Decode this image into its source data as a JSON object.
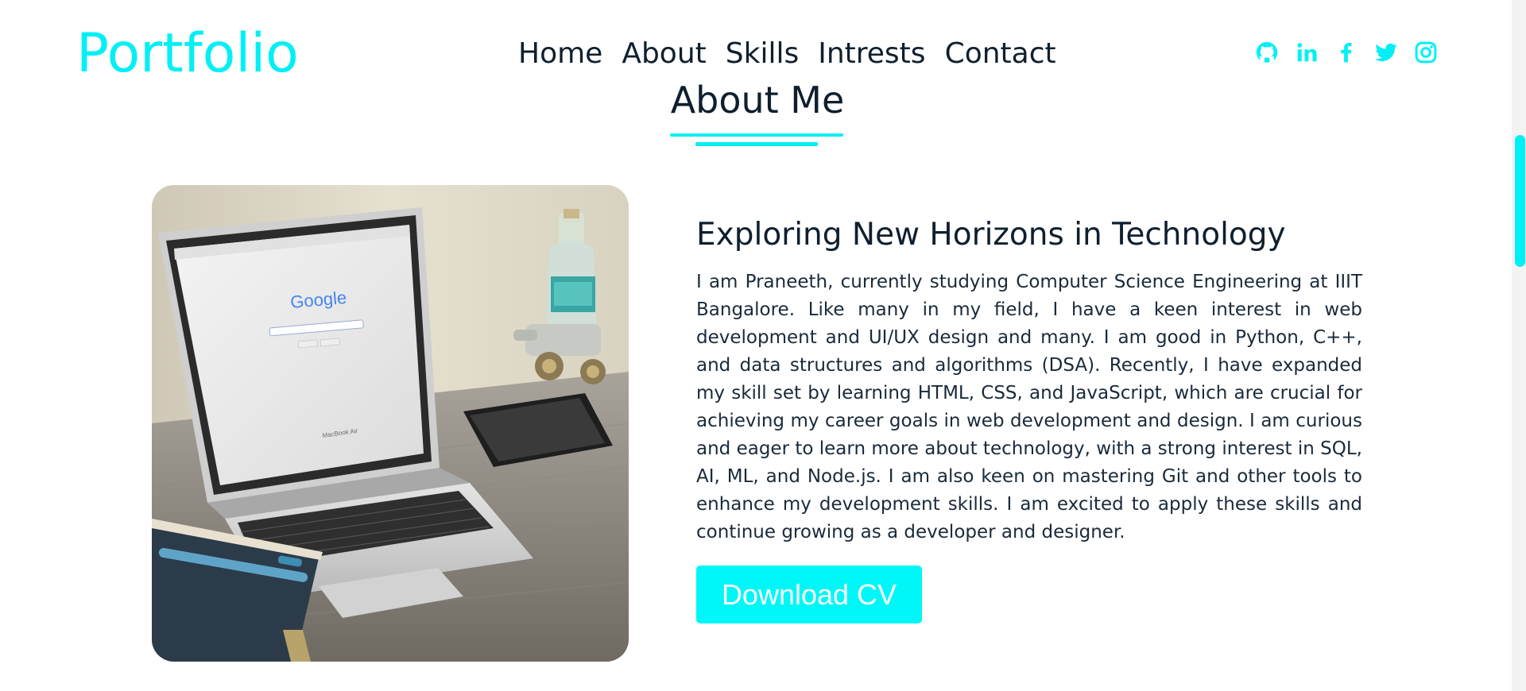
{
  "header": {
    "logo": "Portfolio",
    "nav": [
      "Home",
      "About",
      "Skills",
      "Intrests",
      "Contact"
    ],
    "social_icons": [
      "github-icon",
      "linkedin-icon",
      "facebook-icon",
      "twitter-icon",
      "instagram-icon"
    ]
  },
  "about": {
    "title": "About Me",
    "subtitle": "Exploring New Horizons in Technology",
    "text": "I am Praneeth, currently studying Computer Science Engineering at IIIT Bangalore. Like many in my field, I have a keen interest in web development and UI/UX design and many. I am good in Python, C++, and data structures and algorithms (DSA). Recently, I have expanded my skill set by learning HTML, CSS, and JavaScript, which are crucial for achieving my career goals in web development and design. I am curious and eager to learn more about technology, with a strong interest in SQL, AI, ML, and Node.js. I am also keen on mastering Git and other tools to enhance my development skills. I am excited to apply these skills and continue growing as a developer and designer.",
    "button_label": "Download CV",
    "image": {
      "google_text": "Google",
      "laptop_text": "MacBook Air"
    }
  },
  "colors": {
    "accent": "#00f0f5",
    "text": "#0f1f2e",
    "background": "#ffffff"
  }
}
